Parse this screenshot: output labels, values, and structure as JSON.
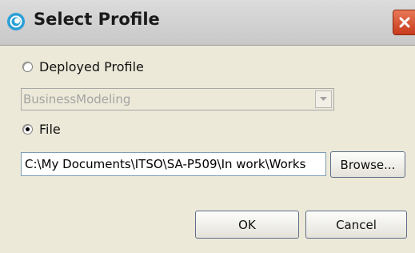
{
  "window": {
    "title": "Select Profile"
  },
  "deployed_profile": {
    "label": "Deployed Profile",
    "selected": false
  },
  "profile_dropdown": {
    "value": "BusinessModeling",
    "enabled": false
  },
  "file_option": {
    "label": "File",
    "selected": true
  },
  "file_path": {
    "value": "C:\\My Documents\\ITSO\\SA-P509\\In work\\Works"
  },
  "buttons": {
    "browse": "Browse...",
    "ok": "OK",
    "cancel": "Cancel"
  },
  "colors": {
    "dialog_bg": "#ece9d8",
    "close_button": "#d9532f",
    "app_icon": "#2a9fd6"
  },
  "icons": {
    "app": "eclipse-ring-icon",
    "close": "close-icon",
    "dropdown": "chevron-down-icon"
  }
}
